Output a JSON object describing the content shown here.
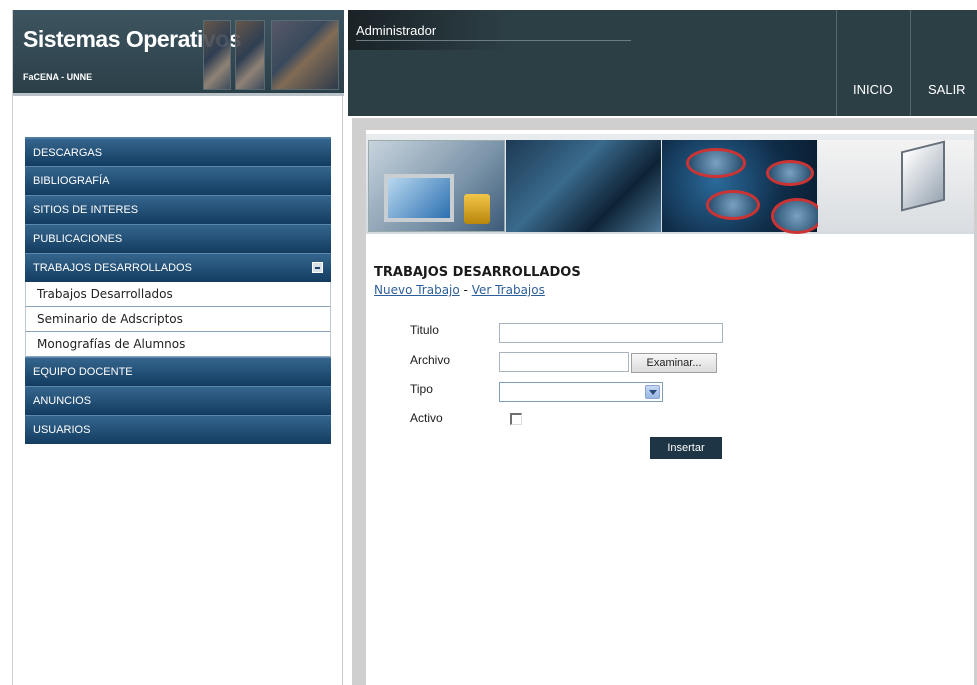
{
  "site": {
    "title": "Sistemas Operativos",
    "subtitle": "FaCENA - UNNE"
  },
  "header": {
    "user": "Administrador",
    "links": [
      "INICIO",
      "SALIR"
    ]
  },
  "sidebar": {
    "items": [
      {
        "label": "DESCARGAS"
      },
      {
        "label": "BIBLIOGRAFÍA"
      },
      {
        "label": "SITIOS DE INTERES"
      },
      {
        "label": "PUBLICACIONES"
      },
      {
        "label": "TRABAJOS DESARROLLADOS",
        "expanded": true
      },
      {
        "label": "EQUIPO DOCENTE"
      },
      {
        "label": "ANUNCIOS"
      },
      {
        "label": "USUARIOS"
      }
    ],
    "sub_items": [
      "Trabajos Desarrollados",
      "Seminario de Adscriptos",
      "Monografías de Alumnos"
    ]
  },
  "main": {
    "heading": "TRABAJOS DESARROLLADOS",
    "links": {
      "new_label": "Nuevo Trabajo",
      "separator": " - ",
      "view_label": "Ver Trabajos"
    },
    "form": {
      "titulo_label": "Titulo",
      "titulo_value": "",
      "archivo_label": "Archivo",
      "archivo_value": "",
      "browse_label": "Examinar...",
      "tipo_label": "Tipo",
      "tipo_value": "",
      "activo_label": "Activo",
      "activo_checked": false,
      "submit_label": "Insertar"
    }
  },
  "colors": {
    "header_bg": "#2c3f45",
    "nav_bg": "#1b4468",
    "link": "#2f5f9a",
    "button_bg": "#1e3546"
  }
}
